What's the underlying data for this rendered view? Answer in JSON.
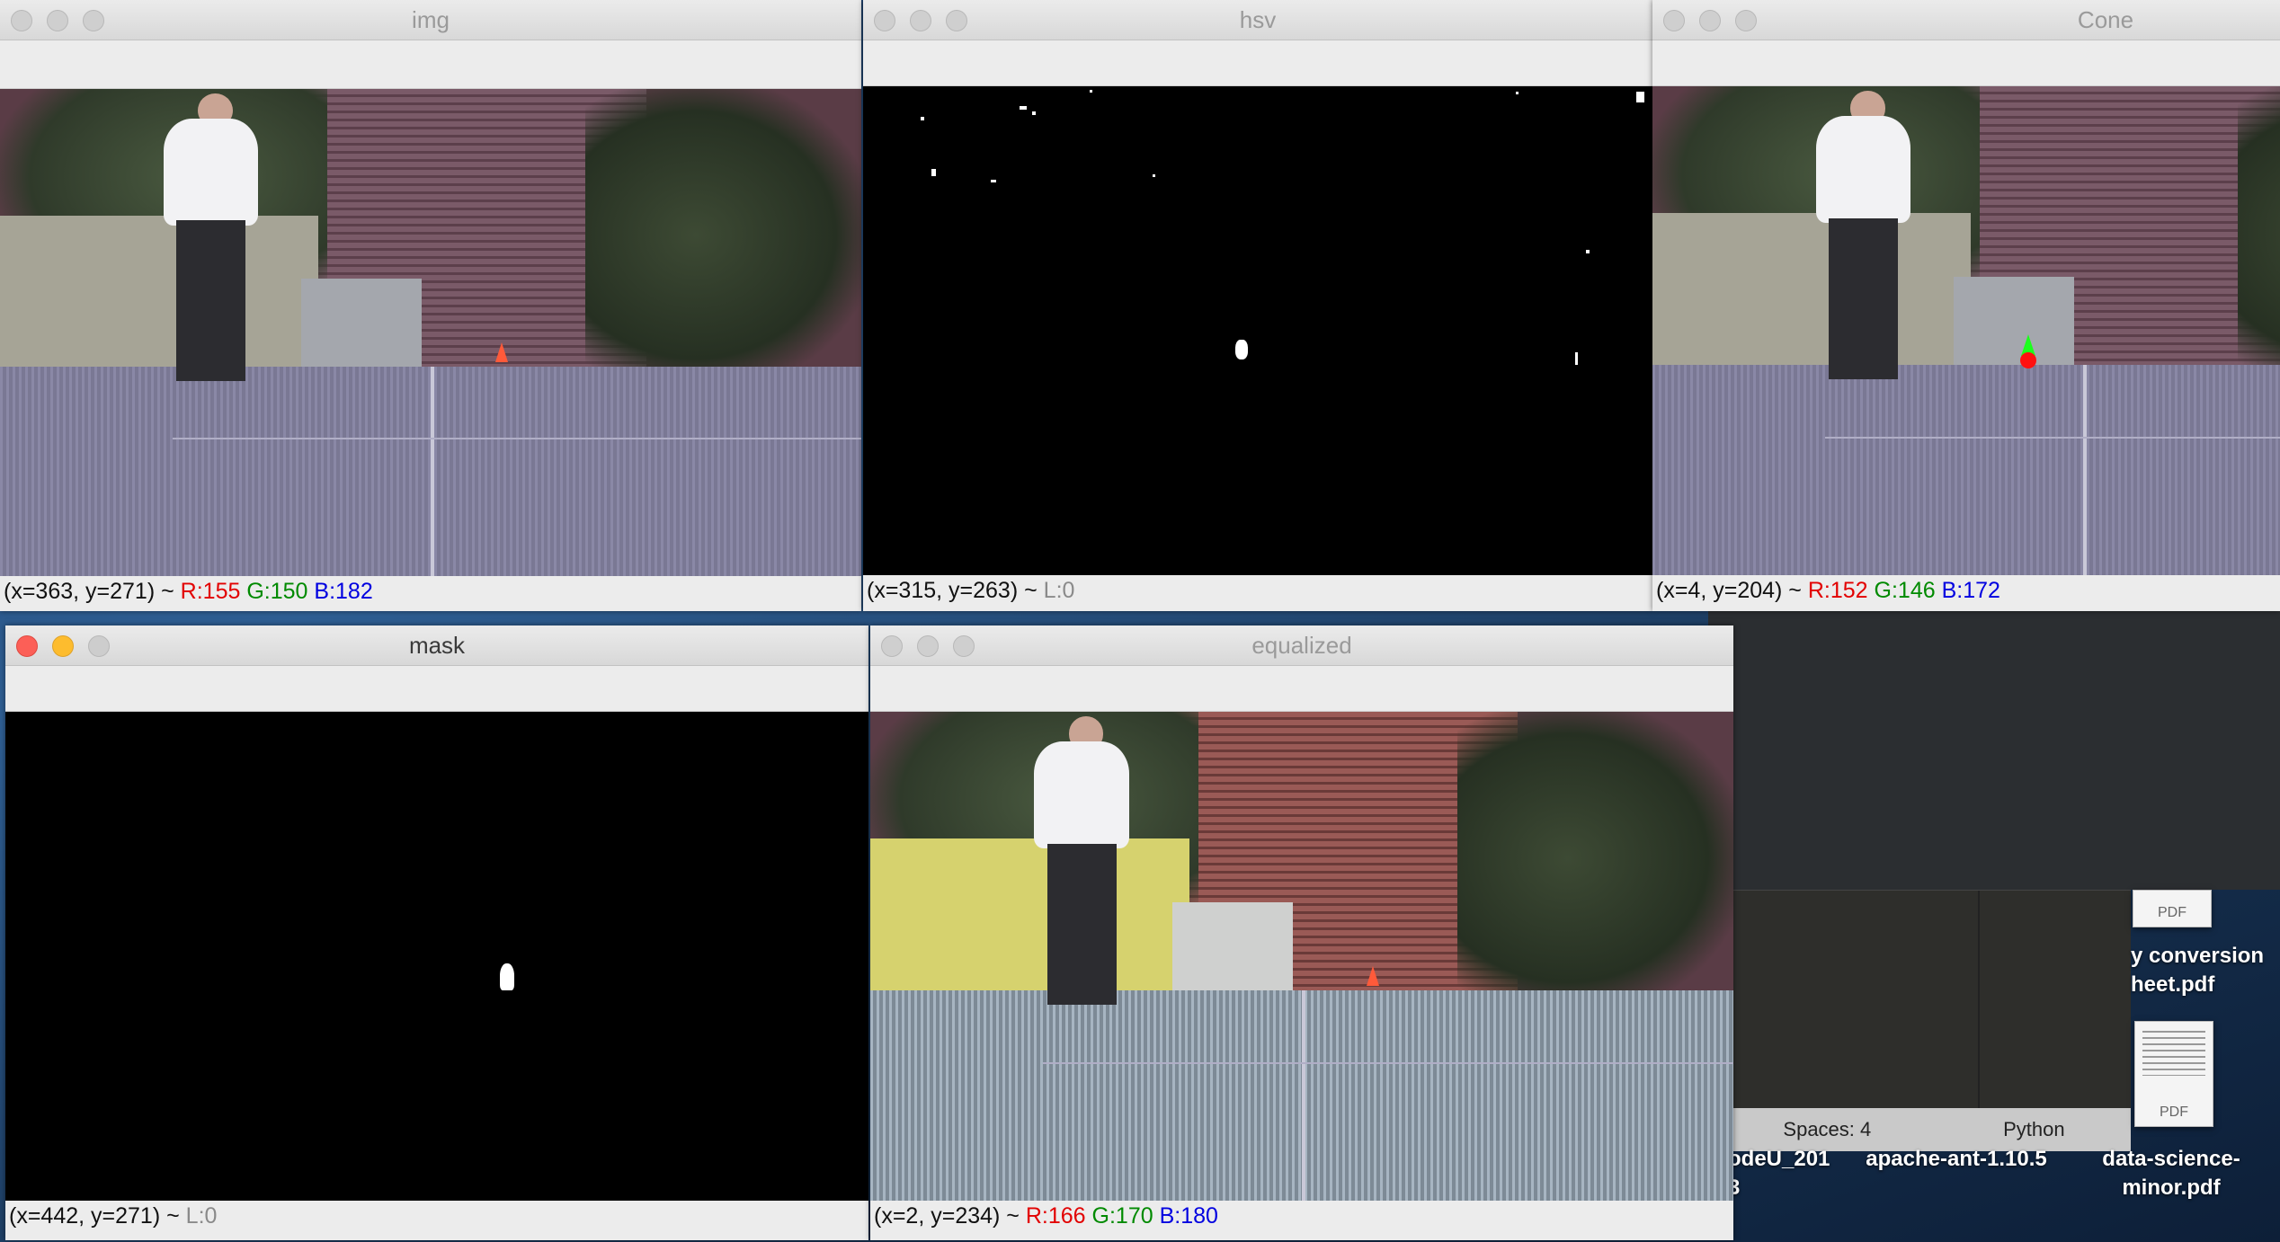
{
  "windows": {
    "img": {
      "title": "img",
      "status": {
        "coords": "(x=363, y=271) ~",
        "r": "R:155",
        "g": "G:150",
        "b": "B:182"
      }
    },
    "hsv": {
      "title": "hsv",
      "status": {
        "coords": "(x=315, y=263) ~",
        "l": "L:0"
      }
    },
    "cone": {
      "title": "Cone",
      "status": {
        "coords": "(x=4, y=204) ~",
        "r": "R:152",
        "g": "G:146",
        "b": "B:172"
      }
    },
    "mask": {
      "title": "mask",
      "status": {
        "coords": "(x=442, y=271) ~",
        "l": "L:0"
      }
    },
    "equalized": {
      "title": "equalized",
      "status": {
        "coords": "(x=2, y=234) ~",
        "r": "R:166",
        "g": "G:170",
        "b": "B:180"
      }
    }
  },
  "editor": {
    "spaces": "Spaces: 4",
    "language": "Python"
  },
  "desktop": {
    "file1_line1": "y conversion",
    "file1_line2": "heet.pdf",
    "file2_line1": "data-science-",
    "file2_line2": "minor.pdf",
    "folder1": "odeU_201",
    "folder1_line2": "3",
    "folder2": "apache-ant-1.10.5",
    "pdf_tag": "PDF"
  }
}
